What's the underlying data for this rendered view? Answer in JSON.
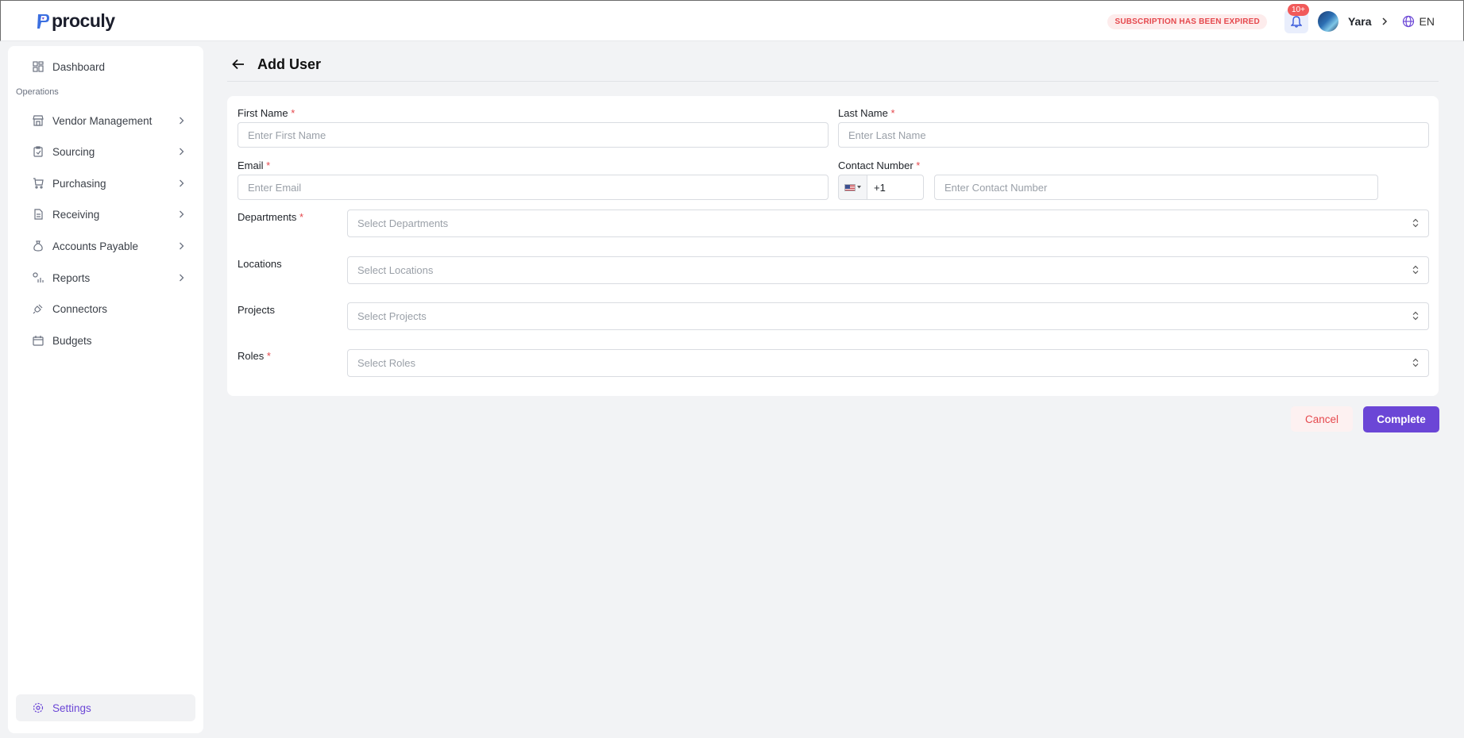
{
  "brand": {
    "name": "proculy",
    "accent": "#6b46d6"
  },
  "topbar": {
    "subscription_notice": "SUBSCRIPTION HAS BEEN EXPIRED",
    "notification_count": "10+",
    "user_name": "Yara",
    "language": "EN"
  },
  "sidebar": {
    "dashboard": "Dashboard",
    "section": "Operations",
    "items": [
      {
        "label": "Vendor Management",
        "icon": "store-icon"
      },
      {
        "label": "Sourcing",
        "icon": "clipboard-icon"
      },
      {
        "label": "Purchasing",
        "icon": "cart-icon"
      },
      {
        "label": "Receiving",
        "icon": "document-icon"
      },
      {
        "label": "Accounts Payable",
        "icon": "money-bag-icon"
      },
      {
        "label": "Reports",
        "icon": "bar-chart-icon"
      },
      {
        "label": "Connectors",
        "icon": "plug-icon"
      },
      {
        "label": "Budgets",
        "icon": "calendar-icon"
      }
    ],
    "settings": "Settings"
  },
  "page": {
    "title": "Add User"
  },
  "form": {
    "first_name": {
      "label": "First Name",
      "placeholder": "Enter First Name"
    },
    "last_name": {
      "label": "Last Name",
      "placeholder": "Enter Last Name"
    },
    "email": {
      "label": "Email",
      "placeholder": "Enter Email"
    },
    "contact": {
      "label": "Contact Number",
      "code": "+1",
      "placeholder": "Enter Contact Number"
    },
    "departments": {
      "label": "Departments",
      "placeholder": "Select Departments"
    },
    "locations": {
      "label": "Locations",
      "placeholder": "Select Locations"
    },
    "projects": {
      "label": "Projects",
      "placeholder": "Select Projects"
    },
    "roles": {
      "label": "Roles",
      "placeholder": "Select Roles"
    },
    "required_mark": "*"
  },
  "actions": {
    "cancel": "Cancel",
    "complete": "Complete"
  }
}
